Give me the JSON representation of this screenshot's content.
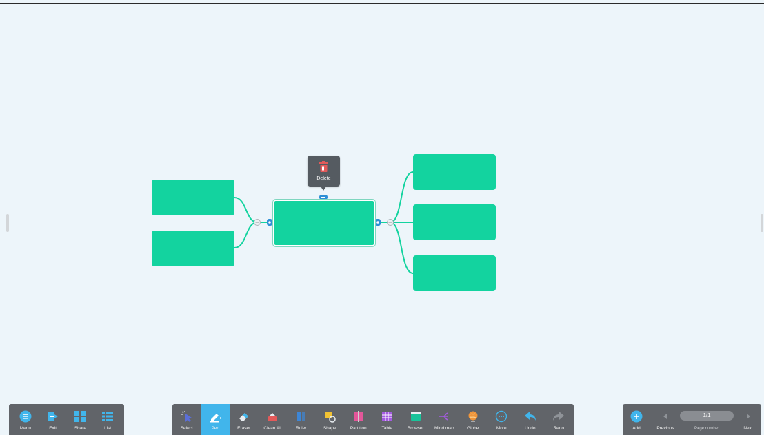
{
  "popup": {
    "delete_label": "Delete"
  },
  "left_toolbar": [
    {
      "label": "Menu",
      "icon": "menu-icon"
    },
    {
      "label": "Exit",
      "icon": "exit-icon"
    },
    {
      "label": "Share",
      "icon": "share-icon"
    },
    {
      "label": "List",
      "icon": "list-icon"
    }
  ],
  "center_toolbar": [
    {
      "label": "Select",
      "icon": "select-icon"
    },
    {
      "label": "Pen",
      "icon": "pen-icon",
      "active": true
    },
    {
      "label": "Eraser",
      "icon": "eraser-icon"
    },
    {
      "label": "Clean All",
      "icon": "clean-all-icon"
    },
    {
      "label": "Ruler",
      "icon": "ruler-icon"
    },
    {
      "label": "Shape",
      "icon": "shape-icon"
    },
    {
      "label": "Partition",
      "icon": "partition-icon"
    },
    {
      "label": "Table",
      "icon": "table-icon"
    },
    {
      "label": "Browser",
      "icon": "browser-icon"
    },
    {
      "label": "Mind map",
      "icon": "mind-map-icon"
    },
    {
      "label": "Globe",
      "icon": "globe-icon"
    },
    {
      "label": "More",
      "icon": "more-icon"
    },
    {
      "label": "Undo",
      "icon": "undo-icon"
    },
    {
      "label": "Redo",
      "icon": "redo-icon"
    }
  ],
  "right_toolbar": {
    "add_label": "Add",
    "previous_label": "Previous",
    "page_indicator": "1/1",
    "page_number_label": "Page number",
    "next_label": "Next"
  },
  "colors": {
    "node": "#13d39f",
    "connector": "#13d39f",
    "accent": "#41b5eb",
    "toolbar": "#616469"
  }
}
